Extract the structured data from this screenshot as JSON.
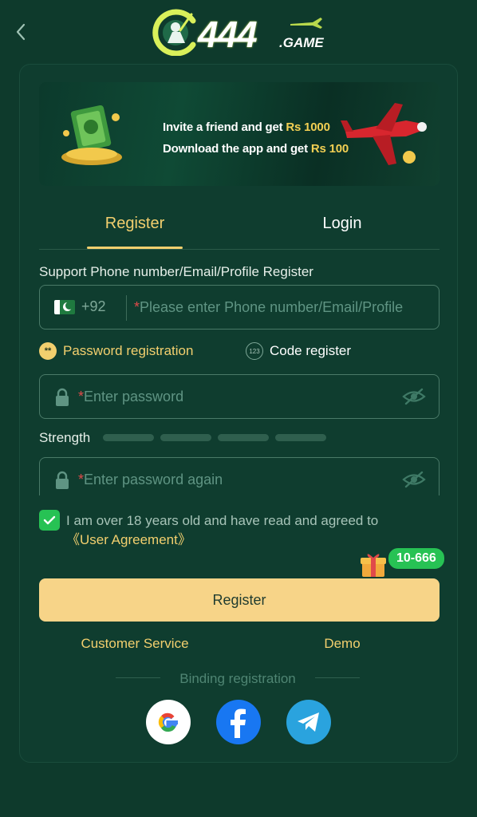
{
  "header": {
    "logo_number": "444",
    "logo_suffix": ".GAME"
  },
  "banner": {
    "line1_text": "Invite a friend and get ",
    "line1_amount": "Rs 1000",
    "line2_text": "Download the app and get ",
    "line2_amount": "Rs 100"
  },
  "tabs": {
    "register": "Register",
    "login": "Login"
  },
  "form": {
    "section_label": "Support Phone number/Email/Profile Register",
    "country_code": "+92",
    "required_mark": "*",
    "phone_placeholder": "Please enter Phone number/Email/Profile",
    "mode_password_icon": "**",
    "mode_password": "Password registration",
    "mode_code_icon": "123",
    "mode_code": "Code register",
    "password_placeholder": "Enter password",
    "strength_label": "Strength",
    "password_again_placeholder": "Enter password again",
    "agree_text": "I am over 18 years old and have read and agreed to",
    "agree_link": "《User Agreement》",
    "agree_checked": true
  },
  "promo": {
    "badge": "10-666"
  },
  "actions": {
    "register_button": "Register",
    "customer_service": "Customer Service",
    "demo": "Demo",
    "binding_label": "Binding registration"
  },
  "social": [
    "google-icon",
    "facebook-icon",
    "telegram-icon"
  ],
  "colors": {
    "background": "#0e3a2c",
    "accent": "#f2cf6e",
    "button": "#f7d488",
    "check": "#27c254"
  }
}
